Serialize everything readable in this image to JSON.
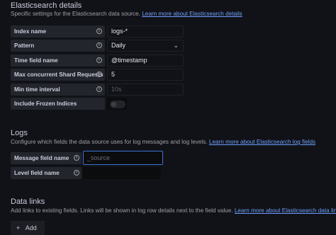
{
  "elasticsearch": {
    "title": "Elasticsearch details",
    "desc": "Specific settings for the Elasticsearch data source.",
    "link": "Learn more about Elasticsearch details",
    "fields": [
      {
        "label": "Index name",
        "value": "logs-*"
      },
      {
        "label": "Pattern",
        "value": "Daily"
      },
      {
        "label": "Time field name",
        "value": "@timestamp"
      },
      {
        "label": "Max concurrent Shard Requests",
        "value": "5"
      },
      {
        "label": "Min time interval",
        "placeholder": "10s"
      },
      {
        "label": "Include Frozen Indices"
      }
    ]
  },
  "logs": {
    "title": "Logs",
    "desc": "Configure which fields the data source uses for log messages and log levels.",
    "link": "Learn more about Elasticsearch log fields",
    "fields": [
      {
        "label": "Message field name",
        "placeholder": "_source"
      },
      {
        "label": "Level field name",
        "value": ""
      }
    ]
  },
  "data_links": {
    "title": "Data links",
    "desc": "Add links to existing fields. Links will be shown in log row details next to the field value.",
    "link": "Learn more about Elasticsearch data links",
    "add_label": "Add",
    "add_icon": "plus-icon"
  },
  "icons": {
    "info": "info-icon",
    "chevron": "chevron-down-icon"
  }
}
